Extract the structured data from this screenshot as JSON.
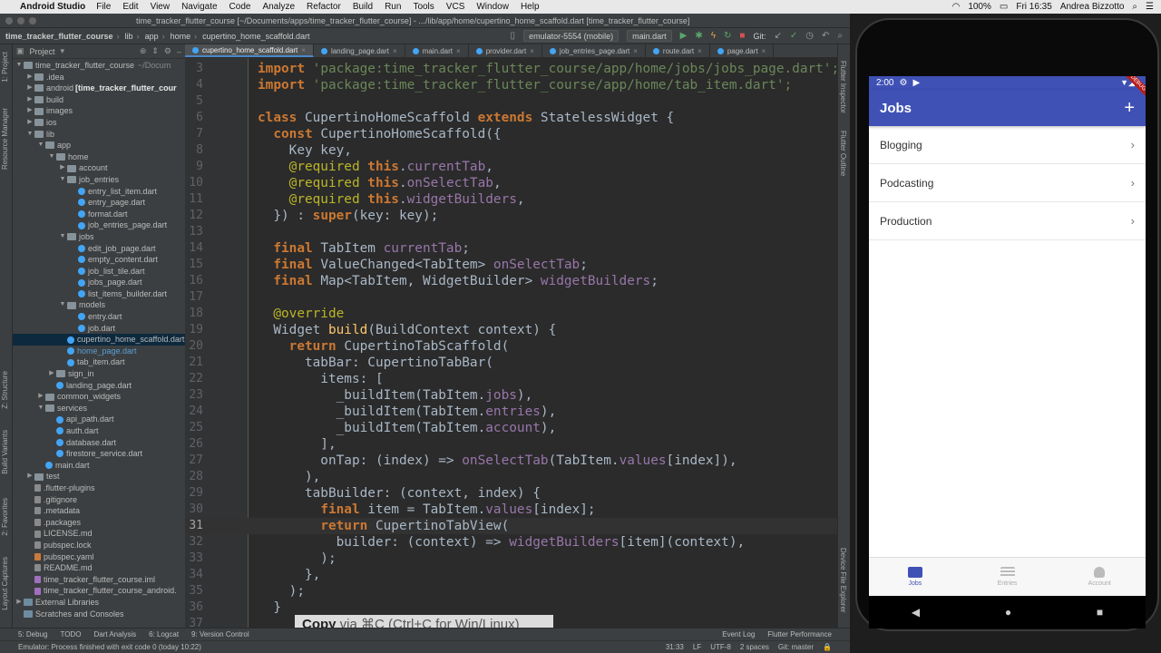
{
  "menubar": {
    "app_name": "Android Studio",
    "items": [
      "File",
      "Edit",
      "View",
      "Navigate",
      "Code",
      "Analyze",
      "Refactor",
      "Build",
      "Run",
      "Tools",
      "VCS",
      "Window",
      "Help"
    ],
    "battery": "100%",
    "date_time": "Fri 16:35",
    "user": "Andrea Bizzotto"
  },
  "window": {
    "title": "time_tracker_flutter_course [~/Documents/apps/time_tracker_flutter_course] - .../lib/app/home/cupertino_home_scaffold.dart [time_tracker_flutter_course]"
  },
  "navbar": {
    "crumbs": [
      "time_tracker_flutter_course",
      "lib",
      "app",
      "home",
      "cupertino_home_scaffold.dart"
    ],
    "device": "emulator-5554 (mobile)",
    "run_config": "main.dart",
    "git_label": "Git:"
  },
  "project": {
    "header": "Project",
    "tree": [
      {
        "label": "time_tracker_flutter_course",
        "extra": "~/Docum",
        "depth": 0,
        "open": true,
        "icon": "folder"
      },
      {
        "label": ".idea",
        "depth": 1,
        "open": false,
        "icon": "folder"
      },
      {
        "label": "android",
        "tag": "[time_tracker_flutter_cour",
        "depth": 1,
        "open": false,
        "icon": "folder"
      },
      {
        "label": "build",
        "depth": 1,
        "open": false,
        "icon": "folder"
      },
      {
        "label": "images",
        "depth": 1,
        "open": false,
        "icon": "folder"
      },
      {
        "label": "ios",
        "depth": 1,
        "open": false,
        "icon": "folder"
      },
      {
        "label": "lib",
        "depth": 1,
        "open": true,
        "icon": "folder"
      },
      {
        "label": "app",
        "depth": 2,
        "open": true,
        "icon": "folder"
      },
      {
        "label": "home",
        "depth": 3,
        "open": true,
        "icon": "folder"
      },
      {
        "label": "account",
        "depth": 4,
        "open": false,
        "icon": "folder"
      },
      {
        "label": "job_entries",
        "depth": 4,
        "open": true,
        "icon": "folder"
      },
      {
        "label": "entry_list_item.dart",
        "depth": 5,
        "icon": "dart"
      },
      {
        "label": "entry_page.dart",
        "depth": 5,
        "icon": "dart"
      },
      {
        "label": "format.dart",
        "depth": 5,
        "icon": "dart"
      },
      {
        "label": "job_entries_page.dart",
        "depth": 5,
        "icon": "dart"
      },
      {
        "label": "jobs",
        "depth": 4,
        "open": true,
        "icon": "folder"
      },
      {
        "label": "edit_job_page.dart",
        "depth": 5,
        "icon": "dart"
      },
      {
        "label": "empty_content.dart",
        "depth": 5,
        "icon": "dart"
      },
      {
        "label": "job_list_tile.dart",
        "depth": 5,
        "icon": "dart"
      },
      {
        "label": "jobs_page.dart",
        "depth": 5,
        "icon": "dart"
      },
      {
        "label": "list_items_builder.dart",
        "depth": 5,
        "icon": "dart"
      },
      {
        "label": "models",
        "depth": 4,
        "open": true,
        "icon": "folder"
      },
      {
        "label": "entry.dart",
        "depth": 5,
        "icon": "dart"
      },
      {
        "label": "job.dart",
        "depth": 5,
        "icon": "dart"
      },
      {
        "label": "cupertino_home_scaffold.dart",
        "depth": 4,
        "icon": "dart",
        "selected": true
      },
      {
        "label": "home_page.dart",
        "depth": 4,
        "icon": "dart",
        "highlight": true
      },
      {
        "label": "tab_item.dart",
        "depth": 4,
        "icon": "dart"
      },
      {
        "label": "sign_in",
        "depth": 3,
        "open": false,
        "icon": "folder"
      },
      {
        "label": "landing_page.dart",
        "depth": 3,
        "icon": "dart"
      },
      {
        "label": "common_widgets",
        "depth": 2,
        "open": false,
        "icon": "folder"
      },
      {
        "label": "services",
        "depth": 2,
        "open": true,
        "icon": "folder"
      },
      {
        "label": "api_path.dart",
        "depth": 3,
        "icon": "dart"
      },
      {
        "label": "auth.dart",
        "depth": 3,
        "icon": "dart"
      },
      {
        "label": "database.dart",
        "depth": 3,
        "icon": "dart"
      },
      {
        "label": "firestore_service.dart",
        "depth": 3,
        "icon": "dart"
      },
      {
        "label": "main.dart",
        "depth": 2,
        "icon": "dart"
      },
      {
        "label": "test",
        "depth": 1,
        "open": false,
        "icon": "folder"
      },
      {
        "label": ".flutter-plugins",
        "depth": 1,
        "icon": "file"
      },
      {
        "label": ".gitignore",
        "depth": 1,
        "icon": "file"
      },
      {
        "label": ".metadata",
        "depth": 1,
        "icon": "file"
      },
      {
        "label": ".packages",
        "depth": 1,
        "icon": "file"
      },
      {
        "label": "LICENSE.md",
        "depth": 1,
        "icon": "file"
      },
      {
        "label": "pubspec.lock",
        "depth": 1,
        "icon": "file"
      },
      {
        "label": "pubspec.yaml",
        "depth": 1,
        "icon": "yaml"
      },
      {
        "label": "README.md",
        "depth": 1,
        "icon": "file"
      },
      {
        "label": "time_tracker_flutter_course.iml",
        "depth": 1,
        "icon": "iml"
      },
      {
        "label": "time_tracker_flutter_course_android.",
        "depth": 1,
        "icon": "iml"
      },
      {
        "label": "External Libraries",
        "depth": 0,
        "open": false,
        "icon": "lib"
      },
      {
        "label": "Scratches and Consoles",
        "depth": 0,
        "icon": "lib"
      }
    ]
  },
  "tabs": [
    {
      "label": "cupertino_home_scaffold.dart",
      "active": true
    },
    {
      "label": "landing_page.dart"
    },
    {
      "label": "main.dart"
    },
    {
      "label": "provider.dart"
    },
    {
      "label": "job_entries_page.dart"
    },
    {
      "label": "route.dart"
    },
    {
      "label": "page.dart"
    }
  ],
  "editor": {
    "current_line": 31,
    "lines": [
      {
        "n": 3,
        "code": [
          [
            "kw",
            "import "
          ],
          [
            "str",
            "'package:time_tracker_flutter_course/app/home/jobs/jobs_page.dart';"
          ]
        ]
      },
      {
        "n": 4,
        "code": [
          [
            "kw",
            "import "
          ],
          [
            "str",
            "'package:time_tracker_flutter_course/app/home/tab_item.dart';"
          ]
        ]
      },
      {
        "n": 5,
        "code": []
      },
      {
        "n": 6,
        "code": [
          [
            "kw",
            "class "
          ],
          [
            "p",
            "CupertinoHomeScaffold "
          ],
          [
            "kw",
            "extends "
          ],
          [
            "p",
            "StatelessWidget {"
          ]
        ]
      },
      {
        "n": 7,
        "code": [
          [
            "p",
            "  "
          ],
          [
            "kw",
            "const "
          ],
          [
            "p",
            "CupertinoHomeScaffold({"
          ]
        ]
      },
      {
        "n": 8,
        "code": [
          [
            "p",
            "    Key key,"
          ]
        ]
      },
      {
        "n": 9,
        "code": [
          [
            "p",
            "    "
          ],
          [
            "ann",
            "@required "
          ],
          [
            "kw",
            "this"
          ],
          [
            "p",
            "."
          ],
          [
            "fld",
            "currentTab"
          ],
          [
            "p",
            ","
          ]
        ]
      },
      {
        "n": 10,
        "code": [
          [
            "p",
            "    "
          ],
          [
            "ann",
            "@required "
          ],
          [
            "kw",
            "this"
          ],
          [
            "p",
            "."
          ],
          [
            "fld",
            "onSelectTab"
          ],
          [
            "p",
            ","
          ]
        ]
      },
      {
        "n": 11,
        "code": [
          [
            "p",
            "    "
          ],
          [
            "ann",
            "@required "
          ],
          [
            "kw",
            "this"
          ],
          [
            "p",
            "."
          ],
          [
            "fld",
            "widgetBuilders"
          ],
          [
            "p",
            ","
          ]
        ]
      },
      {
        "n": 12,
        "code": [
          [
            "p",
            "  }) : "
          ],
          [
            "kw",
            "super"
          ],
          [
            "p",
            "(key: key);"
          ]
        ]
      },
      {
        "n": 13,
        "code": []
      },
      {
        "n": 14,
        "code": [
          [
            "p",
            "  "
          ],
          [
            "kw",
            "final "
          ],
          [
            "p",
            "TabItem "
          ],
          [
            "fld",
            "currentTab"
          ],
          [
            "p",
            ";"
          ]
        ]
      },
      {
        "n": 15,
        "code": [
          [
            "p",
            "  "
          ],
          [
            "kw",
            "final "
          ],
          [
            "p",
            "ValueChanged<TabItem> "
          ],
          [
            "fld",
            "onSelectTab"
          ],
          [
            "p",
            ";"
          ]
        ]
      },
      {
        "n": 16,
        "code": [
          [
            "p",
            "  "
          ],
          [
            "kw",
            "final "
          ],
          [
            "p",
            "Map<TabItem, WidgetBuilder> "
          ],
          [
            "fld",
            "widgetBuilders"
          ],
          [
            "p",
            ";"
          ]
        ]
      },
      {
        "n": 17,
        "code": []
      },
      {
        "n": 18,
        "code": [
          [
            "p",
            "  "
          ],
          [
            "ann",
            "@override"
          ]
        ]
      },
      {
        "n": 19,
        "code": [
          [
            "p",
            "  Widget "
          ],
          [
            "fn",
            "build"
          ],
          [
            "p",
            "(BuildContext context) {"
          ]
        ]
      },
      {
        "n": 20,
        "code": [
          [
            "p",
            "    "
          ],
          [
            "kw",
            "return "
          ],
          [
            "p",
            "CupertinoTabScaffold("
          ]
        ]
      },
      {
        "n": 21,
        "code": [
          [
            "p",
            "      tabBar: CupertinoTabBar("
          ]
        ]
      },
      {
        "n": 22,
        "code": [
          [
            "p",
            "        items: ["
          ]
        ]
      },
      {
        "n": 23,
        "code": [
          [
            "p",
            "          _buildItem(TabItem."
          ],
          [
            "fld",
            "jobs"
          ],
          [
            "p",
            "),"
          ]
        ]
      },
      {
        "n": 24,
        "code": [
          [
            "p",
            "          _buildItem(TabItem."
          ],
          [
            "fld",
            "entries"
          ],
          [
            "p",
            "),"
          ]
        ]
      },
      {
        "n": 25,
        "code": [
          [
            "p",
            "          _buildItem(TabItem."
          ],
          [
            "fld",
            "account"
          ],
          [
            "p",
            "),"
          ]
        ]
      },
      {
        "n": 26,
        "code": [
          [
            "p",
            "        ],"
          ]
        ]
      },
      {
        "n": 27,
        "code": [
          [
            "p",
            "        onTap: (index) => "
          ],
          [
            "fld",
            "onSelectTab"
          ],
          [
            "p",
            "(TabItem."
          ],
          [
            "fld",
            "values"
          ],
          [
            "p",
            "[index]),"
          ]
        ]
      },
      {
        "n": 28,
        "code": [
          [
            "p",
            "      ),"
          ]
        ]
      },
      {
        "n": 29,
        "code": [
          [
            "p",
            "      tabBuilder: (context, index) {"
          ]
        ]
      },
      {
        "n": 30,
        "code": [
          [
            "p",
            "        "
          ],
          [
            "kw",
            "final "
          ],
          [
            "p",
            "item = TabItem."
          ],
          [
            "fld",
            "values"
          ],
          [
            "p",
            "[index];"
          ]
        ]
      },
      {
        "n": 31,
        "code": [
          [
            "p",
            "        "
          ],
          [
            "kw",
            "return "
          ],
          [
            "p",
            "CupertinoTabView("
          ]
        ]
      },
      {
        "n": 32,
        "code": [
          [
            "p",
            "          builder: (context) => "
          ],
          [
            "fld",
            "widgetBuilders"
          ],
          [
            "p",
            "[item](context),"
          ]
        ]
      },
      {
        "n": 33,
        "code": [
          [
            "p",
            "        );"
          ]
        ]
      },
      {
        "n": 34,
        "code": [
          [
            "p",
            "      },"
          ]
        ]
      },
      {
        "n": 35,
        "code": [
          [
            "p",
            "    );"
          ]
        ]
      },
      {
        "n": 36,
        "code": [
          [
            "p",
            "  }"
          ]
        ]
      },
      {
        "n": 37,
        "code": []
      }
    ]
  },
  "hint": {
    "action": "Copy",
    "text": " via ⌘C (Ctrl+C for Win/Linux)"
  },
  "bottom_tools": {
    "left": [
      "5: Debug",
      "TODO",
      "Dart Analysis",
      "6: Logcat",
      "9: Version Control"
    ],
    "right": [
      "Event Log",
      "Flutter Performance"
    ]
  },
  "status": {
    "message": "Emulator: Process finished with exit code 0 (today 10:22)",
    "position": "31:33",
    "line_sep": "LF",
    "encoding": "UTF-8",
    "indent": "2 spaces",
    "branch": "Git: master"
  },
  "side_labels": {
    "left": [
      "1: Project",
      "Resource Manager",
      "Z: Structure",
      "Build Variants",
      "2: Favorites",
      "Layout Captures"
    ],
    "right": [
      "Flutter Inspector",
      "Flutter Outline",
      "Device File Explorer"
    ]
  },
  "phone": {
    "time": "2:00",
    "debug_label": "DEBUG",
    "title": "Jobs",
    "add_label": "+",
    "jobs": [
      "Blogging",
      "Podcasting",
      "Production"
    ],
    "nav": [
      {
        "label": "Jobs",
        "active": true
      },
      {
        "label": "Entries"
      },
      {
        "label": "Account"
      }
    ],
    "sys_back": "◀",
    "sys_home": "●",
    "sys_recent": "■"
  },
  "colors": {
    "accent": "#3f51b5",
    "editor_bg": "#2b2b2b",
    "keyword": "#cc7832",
    "string": "#6a8759",
    "field": "#9876aa",
    "annotation": "#bbb529"
  }
}
